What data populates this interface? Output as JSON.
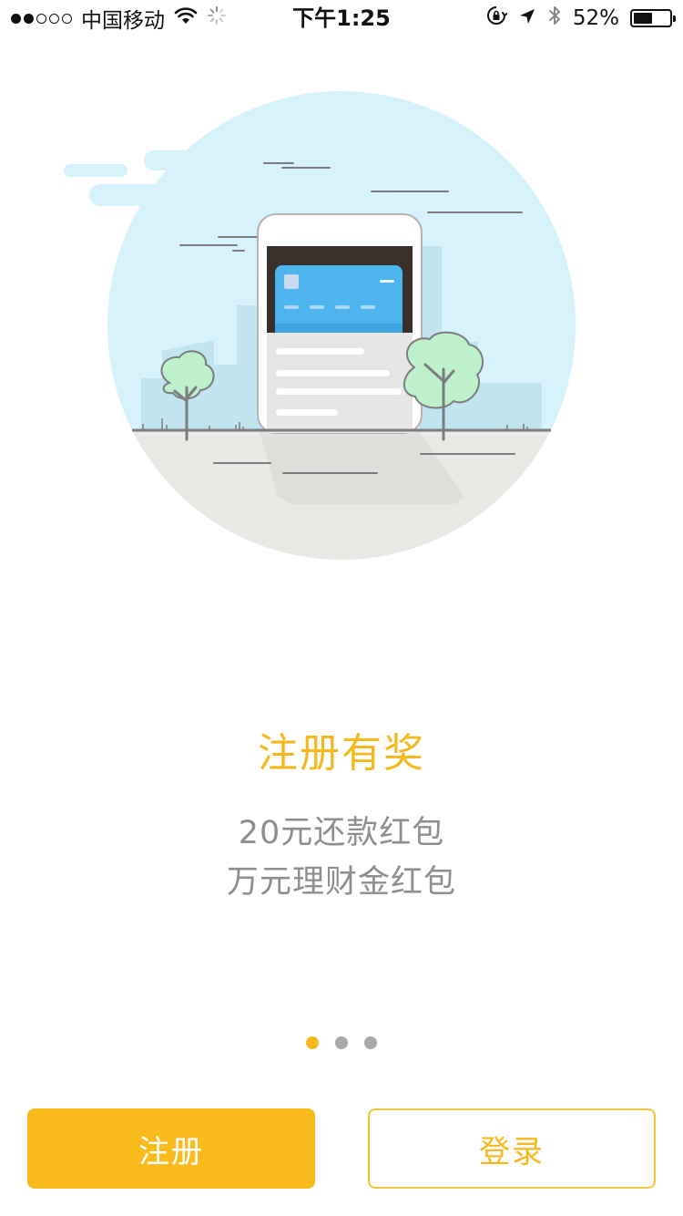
{
  "status_bar": {
    "signal_filled": 2,
    "signal_total": 5,
    "carrier": "中国移动",
    "time": "下午1:25",
    "battery_percent": "52%",
    "battery_level": 0.52,
    "icons": [
      "wifi-icon",
      "loading-spinner-icon",
      "orientation-lock-icon",
      "location-arrow-icon",
      "bluetooth-icon",
      "battery-icon"
    ]
  },
  "onboarding": {
    "title": "注册有奖",
    "line1": "20元还款红包",
    "line2": "万元理财金红包",
    "page_count": 3,
    "active_page": 0,
    "illustration": "phone-with-bank-card-in-city-scene"
  },
  "buttons": {
    "register_label": "注册",
    "login_label": "登录"
  },
  "colors": {
    "accent": "#f9bc1c",
    "title": "#f5b81f",
    "subtitle": "#8e8e8e",
    "sky": "#d8f2fb",
    "ground": "#ebe9e6",
    "card": "#4db4ee",
    "tree": "#bff0cc"
  }
}
